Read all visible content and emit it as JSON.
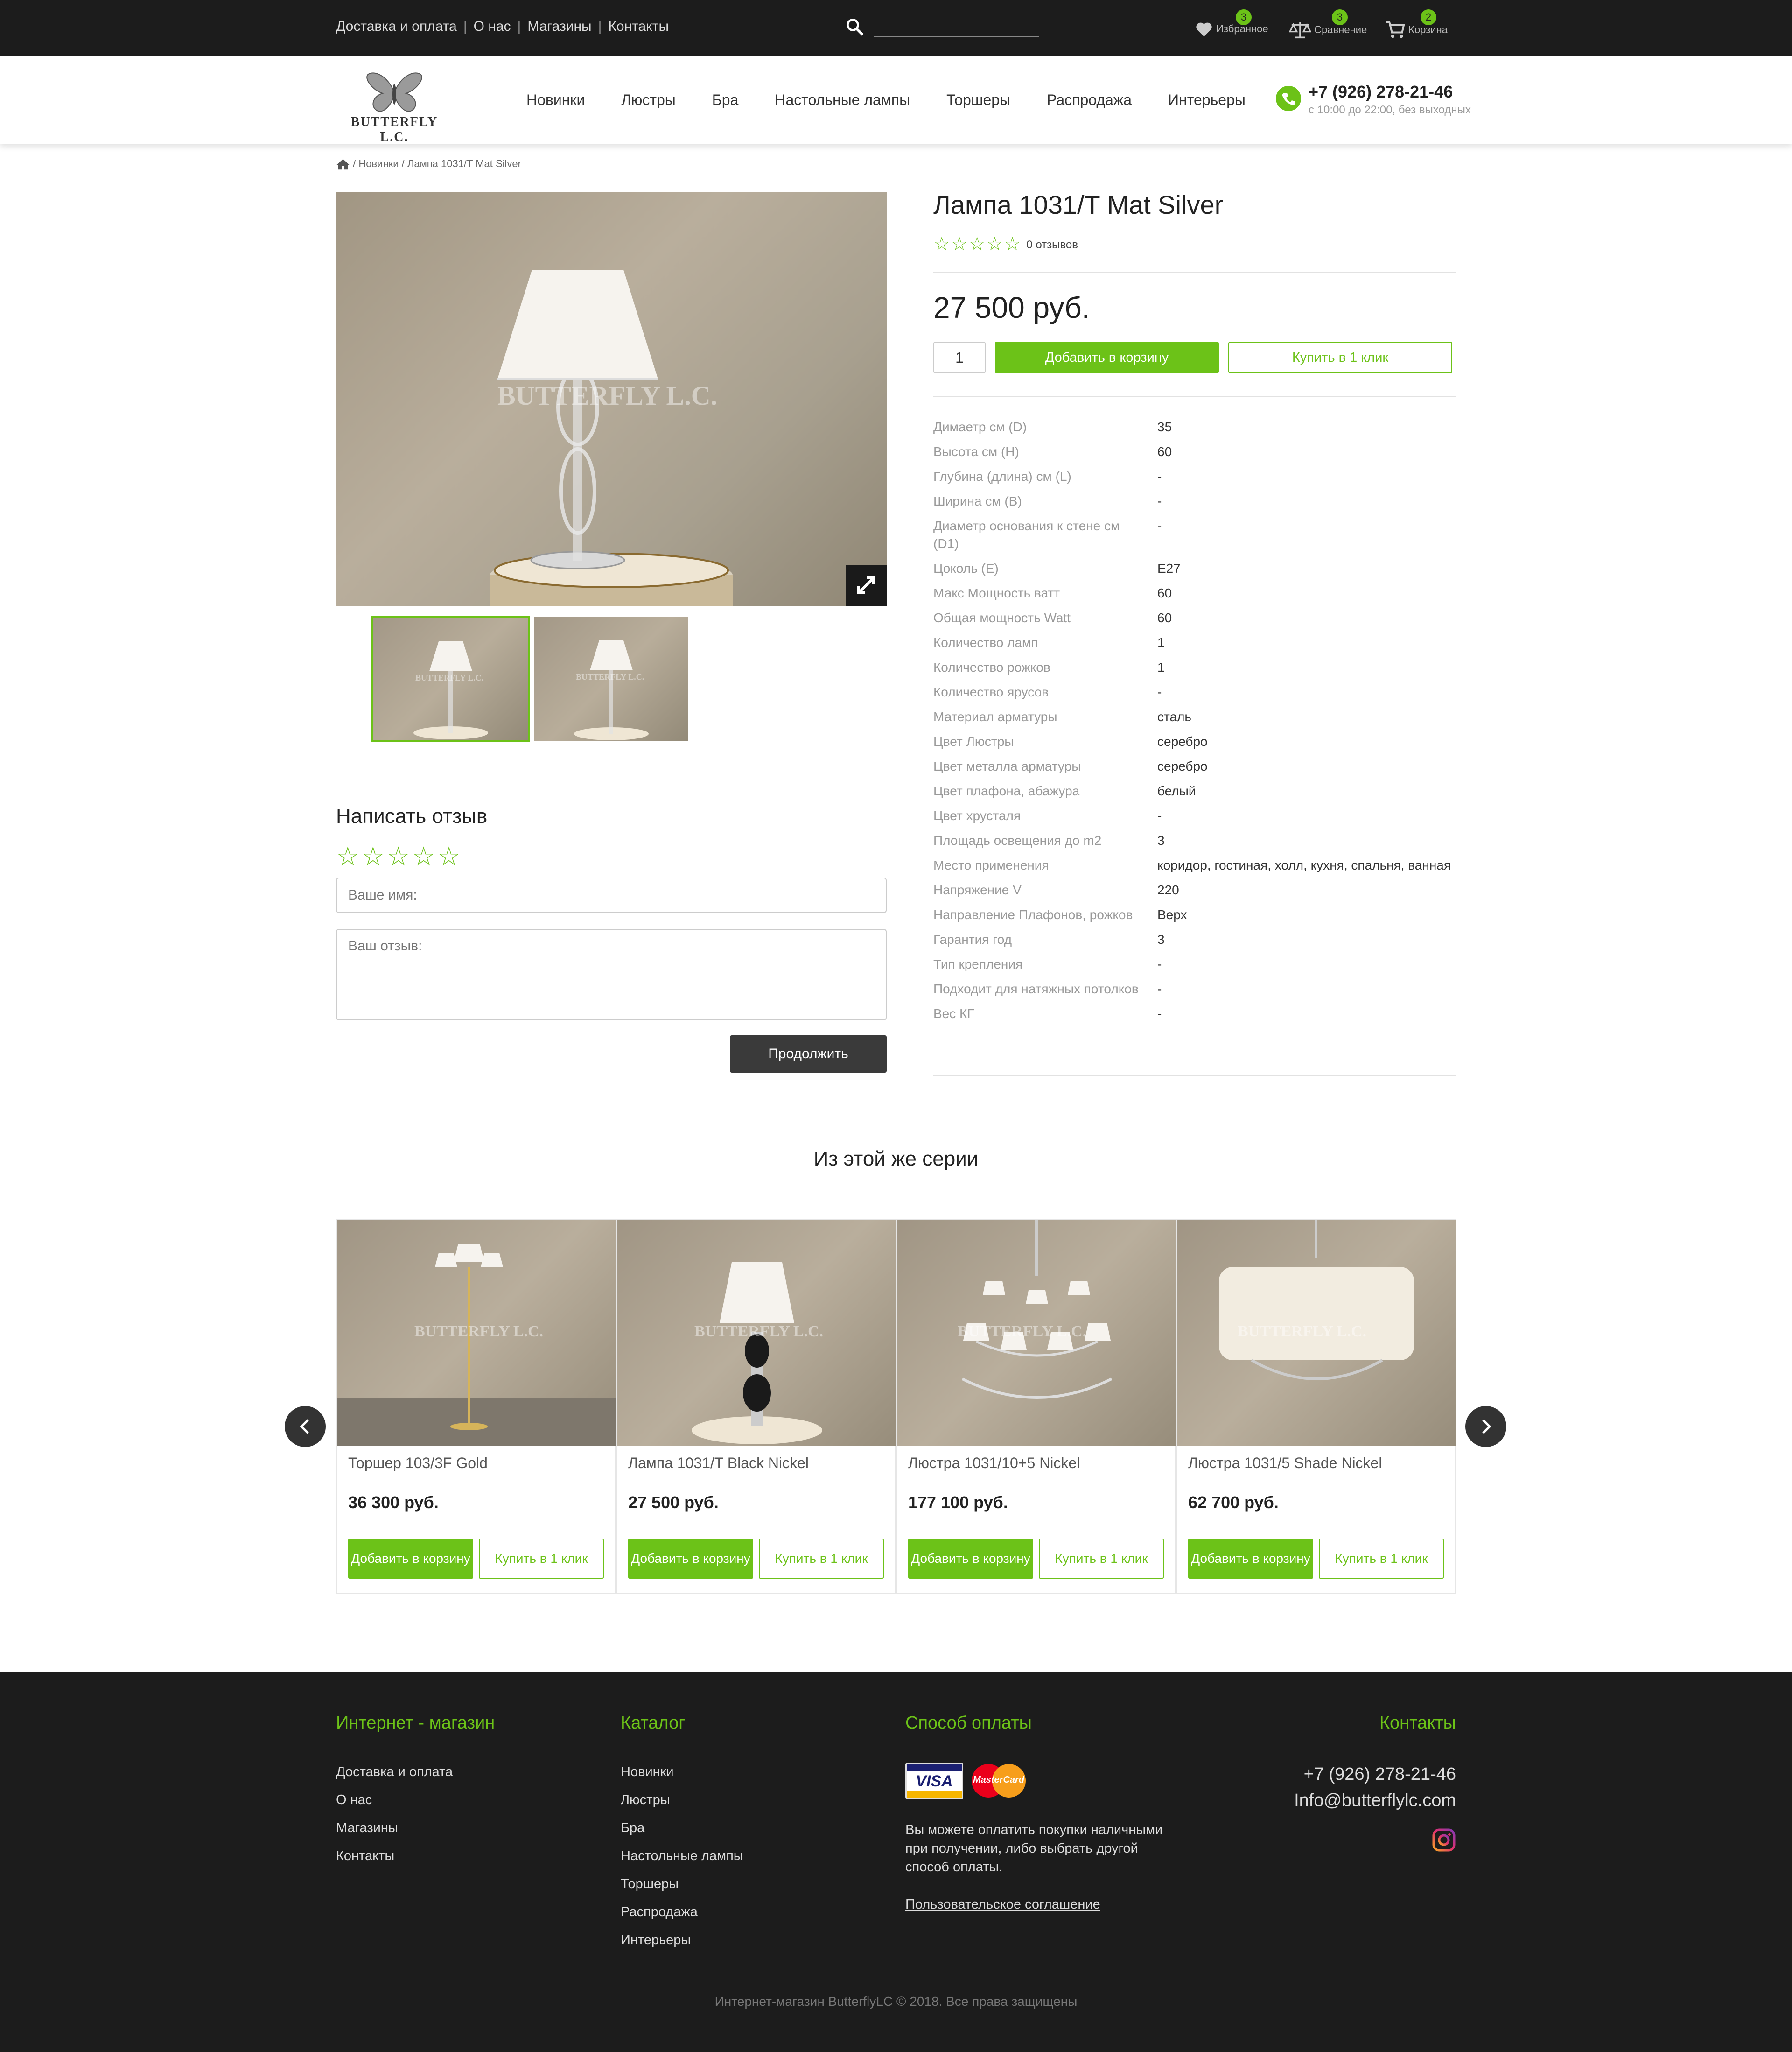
{
  "topbar": {
    "links": [
      "Доставка и оплата",
      "О нас",
      "Магазины",
      "Контакты"
    ],
    "search_placeholder": "",
    "favorites": {
      "label": "Избранное",
      "count": "3"
    },
    "compare": {
      "label": "Сравнение",
      "count": "3"
    },
    "cart": {
      "label": "Корзина",
      "count": "2"
    }
  },
  "header": {
    "logo_text": "BUTTERFLY L.C.",
    "nav": [
      "Новинки",
      "Люстры",
      "Бра",
      "Настольные лампы",
      "Торшеры",
      "Распродажа",
      "Интерьеры"
    ],
    "phone": "+7 (926) 278-21-46",
    "hours": "с 10:00 до 22:00, без выходных"
  },
  "breadcrumb": {
    "sep": "/",
    "items": [
      "Новинки",
      "Лампа 1031/T Mat Silver"
    ]
  },
  "gallery": {
    "watermark": "BUTTERFLY L.C."
  },
  "review": {
    "title": "Написать отзыв",
    "name_placeholder": "Ваше имя:",
    "text_placeholder": "Ваш отзыв:",
    "submit": "Продолжить"
  },
  "product": {
    "title": "Лампа 1031/T Mat Silver",
    "reviews": "0 отзывов",
    "price": "27 500 руб.",
    "qty": "1",
    "add_to_cart": "Добавить в корзину",
    "buy_one_click": "Купить в 1 клик",
    "specs": [
      {
        "k": "Димаетр см (D)",
        "v": "35"
      },
      {
        "k": "Высота см (H)",
        "v": "60"
      },
      {
        "k": "Глубина (длина) см (L)",
        "v": "-"
      },
      {
        "k": "Ширина см (B)",
        "v": "-"
      },
      {
        "k": "Диаметр основания к стене см (D1)",
        "v": "-"
      },
      {
        "k": "Цоколь (E)",
        "v": "E27"
      },
      {
        "k": "Макс Мощность ватт",
        "v": "60"
      },
      {
        "k": "Общая мощность Watt",
        "v": "60"
      },
      {
        "k": "Количество ламп",
        "v": "1"
      },
      {
        "k": "Количество рожков",
        "v": "1"
      },
      {
        "k": "Количество ярусов",
        "v": "-"
      },
      {
        "k": "Материал арматуры",
        "v": "сталь"
      },
      {
        "k": "Цвет Люстры",
        "v": "серебро"
      },
      {
        "k": "Цвет металла арматуры",
        "v": "серебро"
      },
      {
        "k": "Цвет плафона, абажура",
        "v": "белый"
      },
      {
        "k": "Цвет хрусталя",
        "v": "-"
      },
      {
        "k": "Площадь освещения до m2",
        "v": "3"
      },
      {
        "k": "Место применения",
        "v": "коридор, гостиная, холл, кухня, спальня, ванная"
      },
      {
        "k": "Напряжение V",
        "v": "220"
      },
      {
        "k": "Направление Плафонов, рожков",
        "v": "Верх"
      },
      {
        "k": "Гарантия год",
        "v": "3"
      },
      {
        "k": "Тип крепления",
        "v": "-"
      },
      {
        "k": "Подходит для натяжных потолков",
        "v": "-"
      },
      {
        "k": "Вес КГ",
        "v": "-"
      }
    ]
  },
  "series": {
    "title": "Из этой же серии",
    "add_label": "Добавить в корзину",
    "buy_label": "Купить в 1 клик",
    "items": [
      {
        "name": "Торшер 103/3F Gold",
        "price": "36 300 руб."
      },
      {
        "name": "Лампа 1031/T Black Nickel",
        "price": "27 500 руб."
      },
      {
        "name": "Люстра 1031/10+5 Nickel",
        "price": "177 100 руб."
      },
      {
        "name": "Люстра 1031/5 Shade Nickel",
        "price": "62 700 руб."
      }
    ]
  },
  "footer": {
    "shop_title": "Интернет - магазин",
    "shop_links": [
      "Доставка и оплата",
      "О нас",
      "Магазины",
      "Контакты"
    ],
    "catalog_title": "Каталог",
    "catalog_links": [
      "Новинки",
      "Люстры",
      "Бра",
      "Настольные лампы",
      "Торшеры",
      "Распродажа",
      "Интерьеры"
    ],
    "payment_title": "Способ оплаты",
    "visa": "VISA",
    "mastercard": "MasterCard",
    "payment_text": "Вы можете оплатить покупки наличными при получении, либо выбрать другой способ оплаты.",
    "terms": "Пользовательское соглашение",
    "contacts_title": "Контакты",
    "phone": "+7 (926) 278-21-46",
    "email": "Info@butterflylc.com",
    "copyright": "Интернет-магазин ButterflyLC © 2018. Все права защищены"
  },
  "colors": {
    "accent": "#6cc218",
    "dark": "#1c1c1c"
  }
}
